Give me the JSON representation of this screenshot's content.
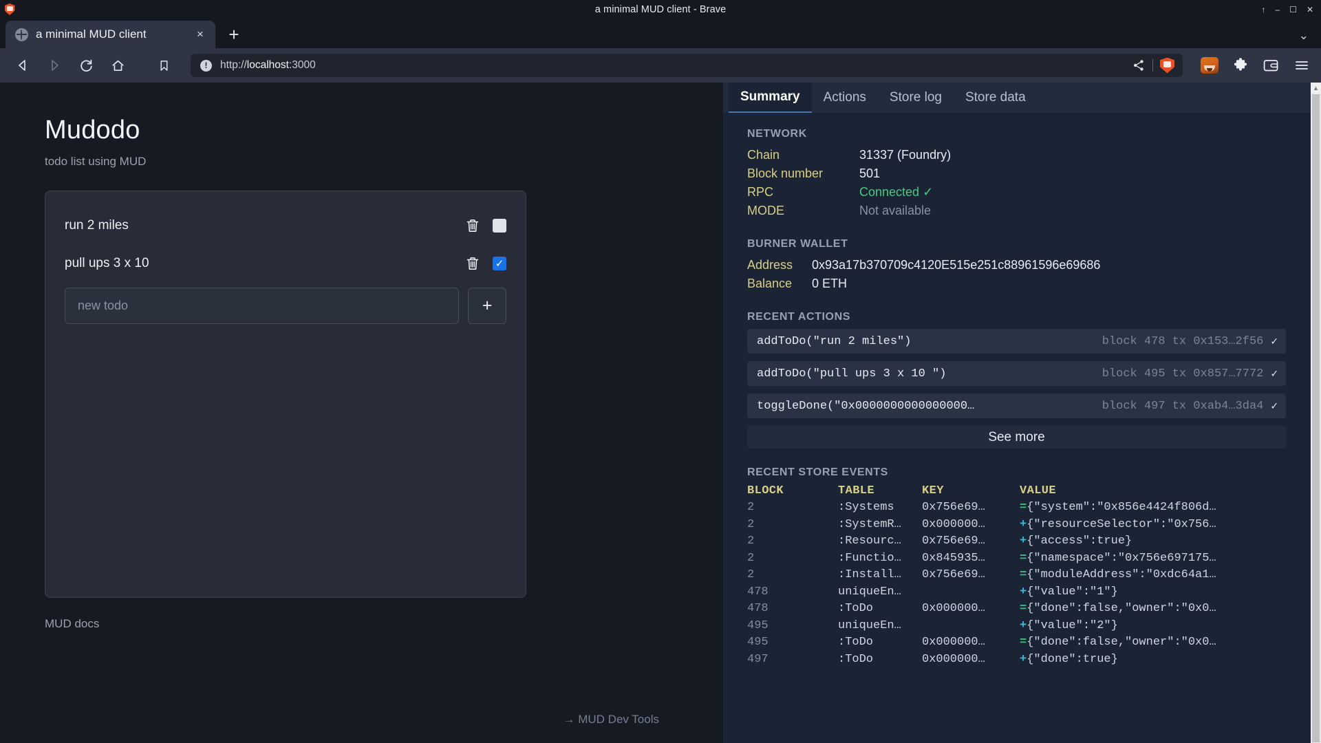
{
  "window": {
    "title": "a minimal MUD client - Brave",
    "controls": [
      "restore-up",
      "minimize",
      "maximize",
      "close"
    ]
  },
  "browser": {
    "tab": {
      "title": "a minimal MUD client",
      "favicon": "globe-icon",
      "close_label": "×"
    },
    "new_tab_label": "+",
    "tab_list_chevron": "⌄",
    "nav": {
      "back": "back-icon",
      "forward": "forward-icon",
      "reload": "reload-icon",
      "home": "home-icon",
      "bookmark": "bookmark-icon"
    },
    "url": {
      "scheme": "http://",
      "host": "localhost",
      "port": ":3000",
      "full": "http://localhost:3000"
    },
    "url_actions": {
      "share": "share-icon",
      "shields": "brave-shields-icon"
    },
    "toolbar_icons": [
      "metamask-fox-icon",
      "extensions-puzzle-icon",
      "wallet-icon",
      "browser-menu-icon"
    ]
  },
  "app": {
    "title": "Mudodo",
    "subtitle": "todo list using MUD",
    "todos": [
      {
        "label": "run 2 miles",
        "done": false
      },
      {
        "label": "pull ups 3 x 10",
        "done": true
      }
    ],
    "new_todo_placeholder": "new todo",
    "new_todo_value": "",
    "add_button_label": "+",
    "docs_link": "MUD docs",
    "devtools_link": "→ MUD Dev Tools"
  },
  "devtools": {
    "tabs": [
      {
        "label": "Summary",
        "active": true
      },
      {
        "label": "Actions",
        "active": false
      },
      {
        "label": "Store log",
        "active": false
      },
      {
        "label": "Store data",
        "active": false
      }
    ],
    "network": {
      "heading": "NETWORK",
      "rows": [
        {
          "key": "Chain",
          "value": "31337 (Foundry)",
          "style": "normal"
        },
        {
          "key": "Block number",
          "value": "501",
          "style": "normal"
        },
        {
          "key": "RPC",
          "value": "Connected ✓",
          "style": "green"
        },
        {
          "key": "MODE",
          "value": "Not available",
          "style": "muted"
        }
      ]
    },
    "burner_wallet": {
      "heading": "BURNER WALLET",
      "rows": [
        {
          "key": "Address",
          "value": "0x93a17b370709c4120E515e251c88961596e69686",
          "style": "normal"
        },
        {
          "key": "Balance",
          "value": "0 ETH",
          "style": "normal"
        }
      ]
    },
    "recent_actions": {
      "heading": "RECENT ACTIONS",
      "items": [
        {
          "call": "addToDo(\"run 2 miles\")",
          "meta": "block 478 tx 0x153…2f56",
          "status": "✓"
        },
        {
          "call": "addToDo(\"pull ups 3 x 10 \")",
          "meta": "block 495 tx 0x857…7772",
          "status": "✓"
        },
        {
          "call": "toggleDone(\"0x0000000000000000…",
          "meta": "block 497 tx 0xab4…3da4",
          "status": "✓"
        }
      ],
      "see_more_label": "See more"
    },
    "store_events": {
      "heading": "RECENT STORE EVENTS",
      "columns": [
        "BLOCK",
        "TABLE",
        "KEY",
        "VALUE"
      ],
      "rows": [
        {
          "block": "2",
          "table": ":Systems",
          "key": "0x756e69…",
          "op": "=",
          "value": "{\"system\":\"0x856e4424f806d…"
        },
        {
          "block": "2",
          "table": ":SystemR…",
          "key": "0x000000…",
          "op": "+",
          "value": "{\"resourceSelector\":\"0x756…"
        },
        {
          "block": "2",
          "table": ":Resourc…",
          "key": "0x756e69…",
          "op": "+",
          "value": "{\"access\":true}"
        },
        {
          "block": "2",
          "table": ":Functio…",
          "key": "0x845935…",
          "op": "=",
          "value": "{\"namespace\":\"0x756e697175…"
        },
        {
          "block": "2",
          "table": ":Install…",
          "key": "0x756e69…",
          "op": "=",
          "value": "{\"moduleAddress\":\"0xdc64a1…"
        },
        {
          "block": "478",
          "table": "uniqueEn…",
          "key": "",
          "op": "+",
          "value": "{\"value\":\"1\"}"
        },
        {
          "block": "478",
          "table": ":ToDo",
          "key": "0x000000…",
          "op": "=",
          "value": "{\"done\":false,\"owner\":\"0x0…"
        },
        {
          "block": "495",
          "table": "uniqueEn…",
          "key": "",
          "op": "+",
          "value": "{\"value\":\"2\"}"
        },
        {
          "block": "495",
          "table": ":ToDo",
          "key": "0x000000…",
          "op": "=",
          "value": "{\"done\":false,\"owner\":\"0x0…"
        },
        {
          "block": "497",
          "table": ":ToDo",
          "key": "0x000000…",
          "op": "+",
          "value": "{\"done\":true}"
        }
      ]
    }
  },
  "colors": {
    "accent_blue": "#1973e8",
    "key_yellow": "#d8cf87",
    "status_green": "#49c97f",
    "op_eq_green": "#3fbf7f",
    "op_plus_cyan": "#3fb8d8",
    "panel_bg": "#1b2434",
    "app_bg": "#151a23"
  }
}
